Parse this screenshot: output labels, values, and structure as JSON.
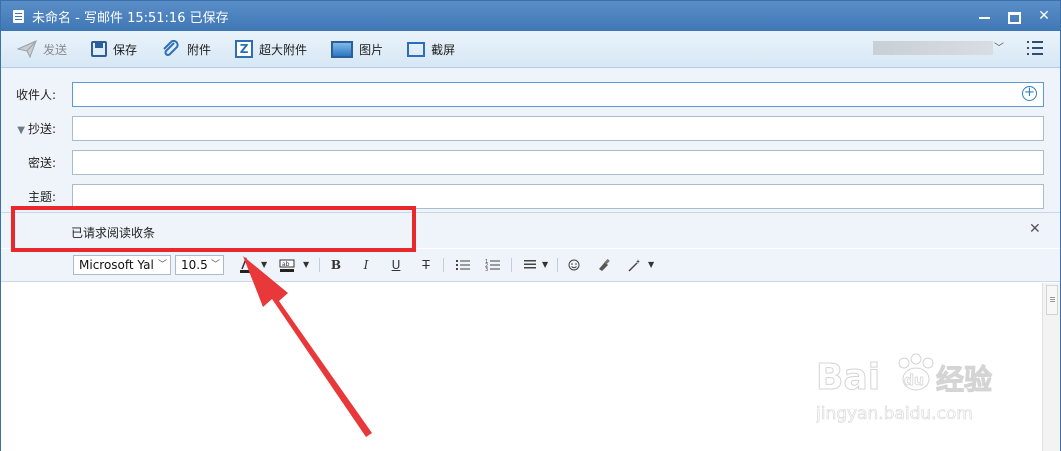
{
  "window": {
    "title": "未命名 - 写邮件   15:51:16 已保存"
  },
  "toolbar": {
    "send_label": "发送",
    "save_label": "保存",
    "attach_label": "附件",
    "big_attach_label": "超大附件",
    "picture_label": "图片",
    "screenshot_label": "截屏"
  },
  "fields": {
    "to_label": "收件人:",
    "cc_label": "抄送:",
    "bcc_label": "密送:",
    "subject_label": "主题:",
    "to_value": "",
    "cc_value": "",
    "bcc_value": "",
    "subject_value": ""
  },
  "receipt": {
    "text": "已请求阅读收条"
  },
  "format": {
    "font_family": "Microsoft Yal",
    "font_size": "10.5",
    "bold": "B",
    "italic": "I",
    "underline": "U",
    "strike": "T"
  },
  "editor": {
    "body": ""
  },
  "annotations": {
    "highlight_color": "#e8282b",
    "arrow_color": "#e8383a"
  },
  "watermark": {
    "logo": "Bai du 经验",
    "sub": "jingyan.baidu.com"
  }
}
